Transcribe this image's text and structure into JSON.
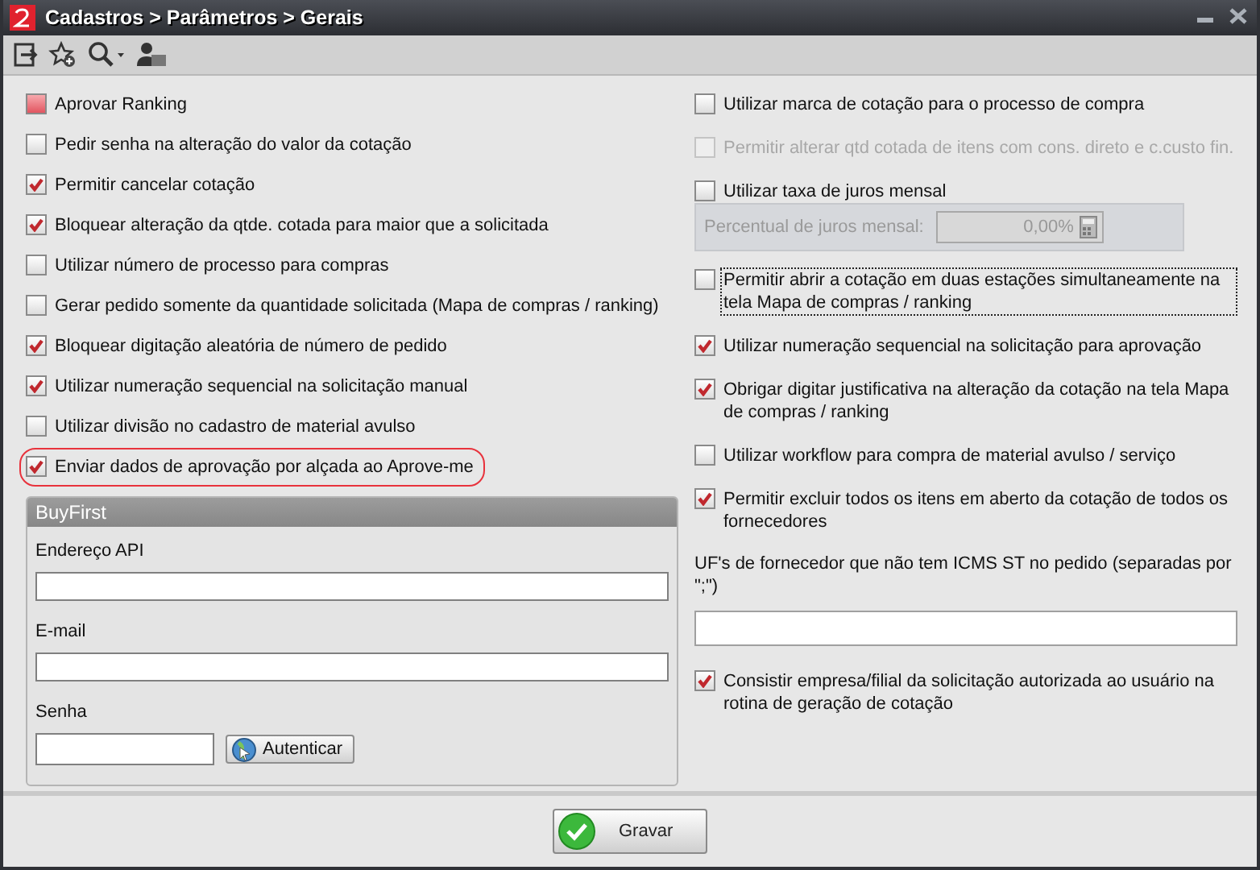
{
  "window": {
    "title": "Cadastros > Parâmetros > Gerais"
  },
  "left_options": [
    {
      "label": "Aprovar Ranking",
      "checked": false,
      "highlighted": true,
      "circled": false
    },
    {
      "label": "Pedir senha na alteração do valor da cotação",
      "checked": false,
      "highlighted": false,
      "circled": false
    },
    {
      "label": "Permitir cancelar cotação",
      "checked": true,
      "highlighted": false,
      "circled": false
    },
    {
      "label": "Bloquear alteração da qtde. cotada para maior que a  solicitada",
      "checked": true,
      "highlighted": false,
      "circled": false
    },
    {
      "label": "Utilizar número de processo para compras",
      "checked": false,
      "highlighted": false,
      "circled": false
    },
    {
      "label": "Gerar pedido somente da quantidade solicitada (Mapa de compras / ranking)",
      "checked": false,
      "highlighted": false,
      "circled": false
    },
    {
      "label": "Bloquear digitação aleatória de número de pedido",
      "checked": true,
      "highlighted": false,
      "circled": false
    },
    {
      "label": "Utilizar numeração sequencial na solicitação manual",
      "checked": true,
      "highlighted": false,
      "circled": false
    },
    {
      "label": "Utilizar divisão no cadastro de material avulso",
      "checked": false,
      "highlighted": false,
      "circled": false
    },
    {
      "label": "Enviar dados de aprovação por alçada ao Aprove-me",
      "checked": true,
      "highlighted": false,
      "circled": true
    }
  ],
  "buyfirst": {
    "title": "BuyFirst",
    "fields": [
      {
        "label": "Endereço API",
        "kind": "wide"
      },
      {
        "label": "E-mail",
        "kind": "wide"
      },
      {
        "label": "Senha",
        "kind": "password"
      }
    ],
    "button": "Autenticar"
  },
  "right_options": [
    {
      "kind": "checkbox",
      "label": "Utilizar marca de cotação  para o processo de compra",
      "checked": false,
      "disabled": false,
      "focused": false
    },
    {
      "kind": "checkbox",
      "label": "Permitir alterar qtd cotada de itens com cons. direto e c.custo fin.",
      "checked": false,
      "disabled": true,
      "focused": false
    },
    {
      "kind": "rate",
      "label": "Utilizar taxa de juros mensal",
      "checked": false,
      "disabled": false,
      "focused": false,
      "rate_field": {
        "label": "Percentual de juros mensal:",
        "value": "0,00%"
      }
    },
    {
      "kind": "checkbox",
      "label": "Permitir abrir a cotação em duas estações simultaneamente na tela Mapa de compras / ranking",
      "checked": false,
      "disabled": false,
      "focused": true
    },
    {
      "kind": "checkbox",
      "label": "Utilizar numeração sequencial na solicitação para aprovação",
      "checked": true,
      "disabled": false,
      "focused": false
    },
    {
      "kind": "checkbox",
      "label": "Obrigar digitar justificativa na alteração da cotação na tela Mapa de compras / ranking",
      "checked": true,
      "disabled": false,
      "focused": false
    },
    {
      "kind": "checkbox",
      "label": "Utilizar workflow para compra de material avulso / serviço",
      "checked": false,
      "disabled": false,
      "focused": false
    },
    {
      "kind": "checkbox",
      "label": "Permitir excluir todos os itens em aberto da cotação de todos os fornecedores",
      "checked": true,
      "disabled": false,
      "focused": false
    },
    {
      "kind": "text-field",
      "label": "UF's de fornecedor que não tem ICMS ST no pedido (separadas por \";\")"
    },
    {
      "kind": "checkbox",
      "label": "Consistir empresa/filial da solicitação autorizada ao usuário na rotina de geração de cotação",
      "checked": true,
      "disabled": false,
      "focused": false
    }
  ],
  "footer": {
    "button": "Gravar"
  }
}
